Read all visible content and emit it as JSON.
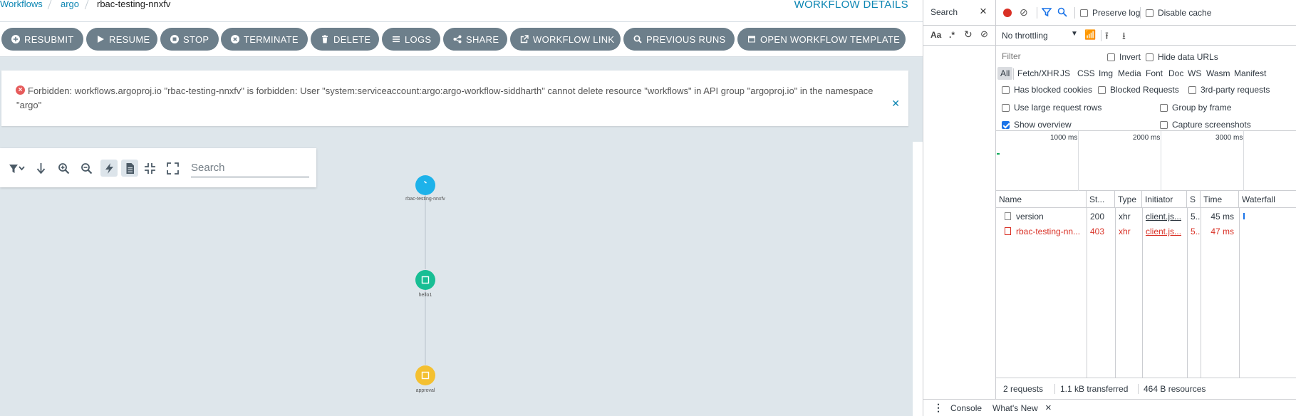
{
  "breadcrumb": {
    "items": [
      "Workflows",
      "argo",
      "rbac-testing-nnxfv"
    ]
  },
  "page_title": "WORKFLOW DETAILS",
  "toolbar": {
    "buttons": [
      "RESUBMIT",
      "RESUME",
      "STOP",
      "TERMINATE",
      "DELETE",
      "LOGS",
      "SHARE",
      "WORKFLOW LINK",
      "PREVIOUS RUNS",
      "OPEN WORKFLOW TEMPLATE"
    ]
  },
  "error": {
    "message": "Forbidden: workflows.argoproj.io \"rbac-testing-nnxfv\" is forbidden: User \"system:serviceaccount:argo:argo-workflow-siddharth\" cannot delete resource \"workflows\" in API group \"argoproj.io\" in the namespace \"argo\"",
    "icon": "error-circle-icon",
    "close_icon": "close-icon",
    "color": "#e65b5b"
  },
  "graph": {
    "search_placeholder": "Search",
    "nodes": [
      {
        "label": "rbac-testing-nnxfv",
        "color": "#1db2ea"
      },
      {
        "label": "hello1",
        "color": "#18be94"
      },
      {
        "label": "approval",
        "color": "#f4c030"
      }
    ]
  },
  "devtools": {
    "search_tab": "Search",
    "search_tools": [
      "Aa",
      ".*"
    ],
    "preserve_log": "Preserve log",
    "disable_cache": "Disable cache",
    "throttling": "No throttling",
    "filter_placeholder": "Filter",
    "invert": "Invert",
    "hide_data_urls": "Hide data URLs",
    "types": [
      "All",
      "Fetch/XHR",
      "JS",
      "CSS",
      "Img",
      "Media",
      "Font",
      "Doc",
      "WS",
      "Wasm",
      "Manifest"
    ],
    "has_blocked_cookies": "Has blocked cookies",
    "blocked_requests": "Blocked Requests",
    "third_party": "3rd-party requests",
    "large_rows": "Use large request rows",
    "group_by_frame": "Group by frame",
    "show_overview": "Show overview",
    "capture_screenshots": "Capture screenshots",
    "overview_ticks": [
      "1000 ms",
      "2000 ms",
      "3000 ms"
    ],
    "columns": [
      "Name",
      "St...",
      "Type",
      "Initiator",
      "S",
      "Time",
      "Waterfall"
    ],
    "rows": [
      {
        "name": "version",
        "status": "200",
        "type": "xhr",
        "initiator": "client.js...",
        "size": "5...",
        "time": "45 ms",
        "error": false
      },
      {
        "name": "rbac-testing-nn...",
        "status": "403",
        "type": "xhr",
        "initiator": "client.js...",
        "size": "5...",
        "time": "47 ms",
        "error": true
      }
    ],
    "status": {
      "requests": "2 requests",
      "transferred": "1.1 kB transferred",
      "resources": "464 B resources"
    },
    "drawer_tabs": [
      "Console",
      "What's New"
    ]
  }
}
